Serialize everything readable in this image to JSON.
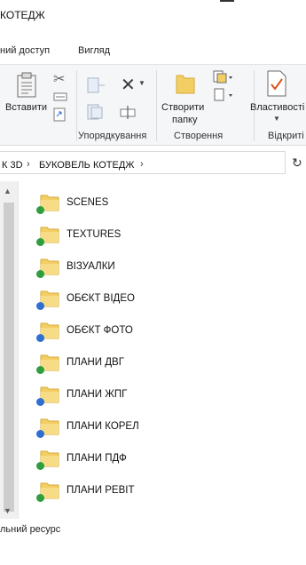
{
  "window": {
    "title": "КОТЕДЖ"
  },
  "ribbon_tabs": [
    "ний доступ",
    "Вигляд"
  ],
  "ribbon": {
    "paste_label": "Вставити",
    "new_folder_label_1": "Створити",
    "new_folder_label_2": "папку",
    "properties_label": "Властивості",
    "groups": {
      "organize": "Упорядкування",
      "new": "Створення",
      "open": "Відкриті"
    }
  },
  "address": {
    "crumbs": [
      "К 3D",
      "БУКОВЕЛЬ КОТЕДЖ"
    ]
  },
  "files": [
    {
      "name": "SCENES",
      "status": "synced"
    },
    {
      "name": "TEXTURES",
      "status": "synced"
    },
    {
      "name": "ВІЗУАЛКИ",
      "status": "synced"
    },
    {
      "name": "ОБЄКТ ВІДЕО",
      "status": "cloud"
    },
    {
      "name": "ОБЄКТ ФОТО",
      "status": "cloud"
    },
    {
      "name": "ПЛАНИ ДВГ",
      "status": "synced"
    },
    {
      "name": "ПЛАНИ ЖПГ",
      "status": "cloud"
    },
    {
      "name": "ПЛАНИ КОРЕЛ",
      "status": "cloud"
    },
    {
      "name": "ПЛАНИ ПДФ",
      "status": "synced"
    },
    {
      "name": "ПЛАНИ РЕВІТ",
      "status": "synced"
    }
  ],
  "status_bar": {
    "text": "льний ресурс"
  },
  "colors": {
    "folder": "#f3cf63",
    "synced": "#2e9e3e",
    "cloud": "#2f6fd1",
    "accent": "#0078d7"
  }
}
